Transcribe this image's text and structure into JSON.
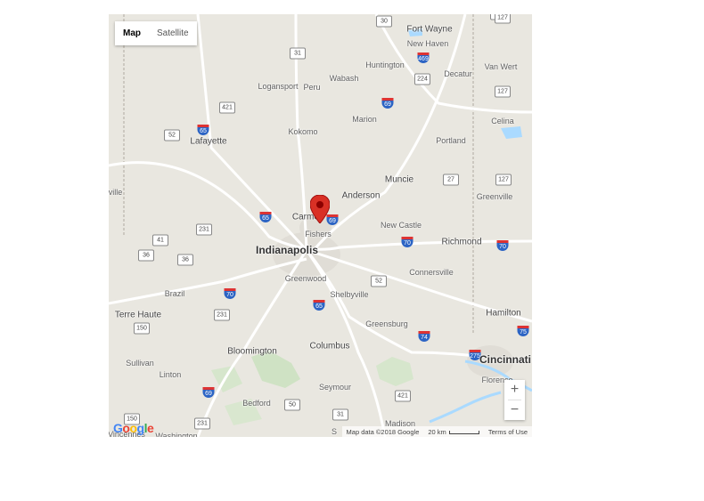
{
  "map_type": {
    "map": "Map",
    "satellite": "Satellite"
  },
  "zoom": {
    "in": "+",
    "out": "−"
  },
  "logo": [
    "G",
    "o",
    "o",
    "g",
    "l",
    "e"
  ],
  "logo_colors": [
    "#4285f4",
    "#ea4335",
    "#fbbc05",
    "#4285f4",
    "#34a853",
    "#ea4335"
  ],
  "attribution": {
    "data": "Map data ©2018 Google",
    "scale": "20 km",
    "terms": "Terms of Use"
  },
  "marker_color": "#d93025",
  "cities": [
    {
      "name": "Fort Wayne",
      "cls": "mid"
    },
    {
      "name": "New Haven",
      "cls": ""
    },
    {
      "name": "Huntington",
      "cls": ""
    },
    {
      "name": "Decatur",
      "cls": ""
    },
    {
      "name": "Van Wert",
      "cls": ""
    },
    {
      "name": "Logansport",
      "cls": ""
    },
    {
      "name": "Peru",
      "cls": ""
    },
    {
      "name": "Wabash",
      "cls": ""
    },
    {
      "name": "Marion",
      "cls": ""
    },
    {
      "name": "Celina",
      "cls": ""
    },
    {
      "name": "Lafayette",
      "cls": "mid"
    },
    {
      "name": "Kokomo",
      "cls": ""
    },
    {
      "name": "Portland",
      "cls": ""
    },
    {
      "name": "Muncie",
      "cls": "mid"
    },
    {
      "name": "Anderson",
      "cls": "mid"
    },
    {
      "name": "Greenville",
      "cls": ""
    },
    {
      "name": "nville",
      "cls": ""
    },
    {
      "name": "Carmel",
      "cls": "mid"
    },
    {
      "name": "Fishers",
      "cls": ""
    },
    {
      "name": "New Castle",
      "cls": ""
    },
    {
      "name": "Richmond",
      "cls": "mid"
    },
    {
      "name": "Indianapolis",
      "cls": "big"
    },
    {
      "name": "Connersville",
      "cls": ""
    },
    {
      "name": "Brazil",
      "cls": ""
    },
    {
      "name": "Greenwood",
      "cls": ""
    },
    {
      "name": "Shelbyville",
      "cls": ""
    },
    {
      "name": "Terre Haute",
      "cls": "mid"
    },
    {
      "name": "Hamilton",
      "cls": "mid"
    },
    {
      "name": "Greensburg",
      "cls": ""
    },
    {
      "name": "Bloomington",
      "cls": "mid"
    },
    {
      "name": "Columbus",
      "cls": "mid"
    },
    {
      "name": "Cincinnati",
      "cls": "big"
    },
    {
      "name": "Sullivan",
      "cls": ""
    },
    {
      "name": "Linton",
      "cls": ""
    },
    {
      "name": "Florence",
      "cls": ""
    },
    {
      "name": "Seymour",
      "cls": ""
    },
    {
      "name": "Bedford",
      "cls": ""
    },
    {
      "name": "Madison",
      "cls": ""
    },
    {
      "name": "Vincennes",
      "cls": ""
    },
    {
      "name": "Washington",
      "cls": ""
    },
    {
      "name": "S",
      "cls": ""
    }
  ],
  "highways": [
    {
      "label": "30",
      "type": "us"
    },
    {
      "label": "469",
      "type": "i"
    },
    {
      "label": "31",
      "type": "us"
    },
    {
      "label": "224",
      "type": "us"
    },
    {
      "label": "127",
      "type": "us"
    },
    {
      "label": "69",
      "type": "i"
    },
    {
      "label": "421",
      "type": "us"
    },
    {
      "label": "65",
      "type": "i"
    },
    {
      "label": "52",
      "type": "us"
    },
    {
      "label": "27",
      "type": "us"
    },
    {
      "label": "127",
      "type": "us"
    },
    {
      "label": "65",
      "type": "i"
    },
    {
      "label": "69",
      "type": "i"
    },
    {
      "label": "231",
      "type": "us"
    },
    {
      "label": "41",
      "type": "us"
    },
    {
      "label": "70",
      "type": "i"
    },
    {
      "label": "70",
      "type": "i"
    },
    {
      "label": "36",
      "type": "us"
    },
    {
      "label": "36",
      "type": "us"
    },
    {
      "label": "52",
      "type": "us"
    },
    {
      "label": "70",
      "type": "i"
    },
    {
      "label": "231",
      "type": "us"
    },
    {
      "label": "65",
      "type": "i"
    },
    {
      "label": "150",
      "type": "us"
    },
    {
      "label": "74",
      "type": "i"
    },
    {
      "label": "75",
      "type": "i"
    },
    {
      "label": "275",
      "type": "i"
    },
    {
      "label": "421",
      "type": "us"
    },
    {
      "label": "69",
      "type": "i"
    },
    {
      "label": "50",
      "type": "us"
    },
    {
      "label": "31",
      "type": "us"
    },
    {
      "label": "231",
      "type": "us"
    },
    {
      "label": "150",
      "type": "us"
    },
    {
      "label": "30",
      "type": "us"
    },
    {
      "label": "127",
      "type": "us"
    }
  ]
}
